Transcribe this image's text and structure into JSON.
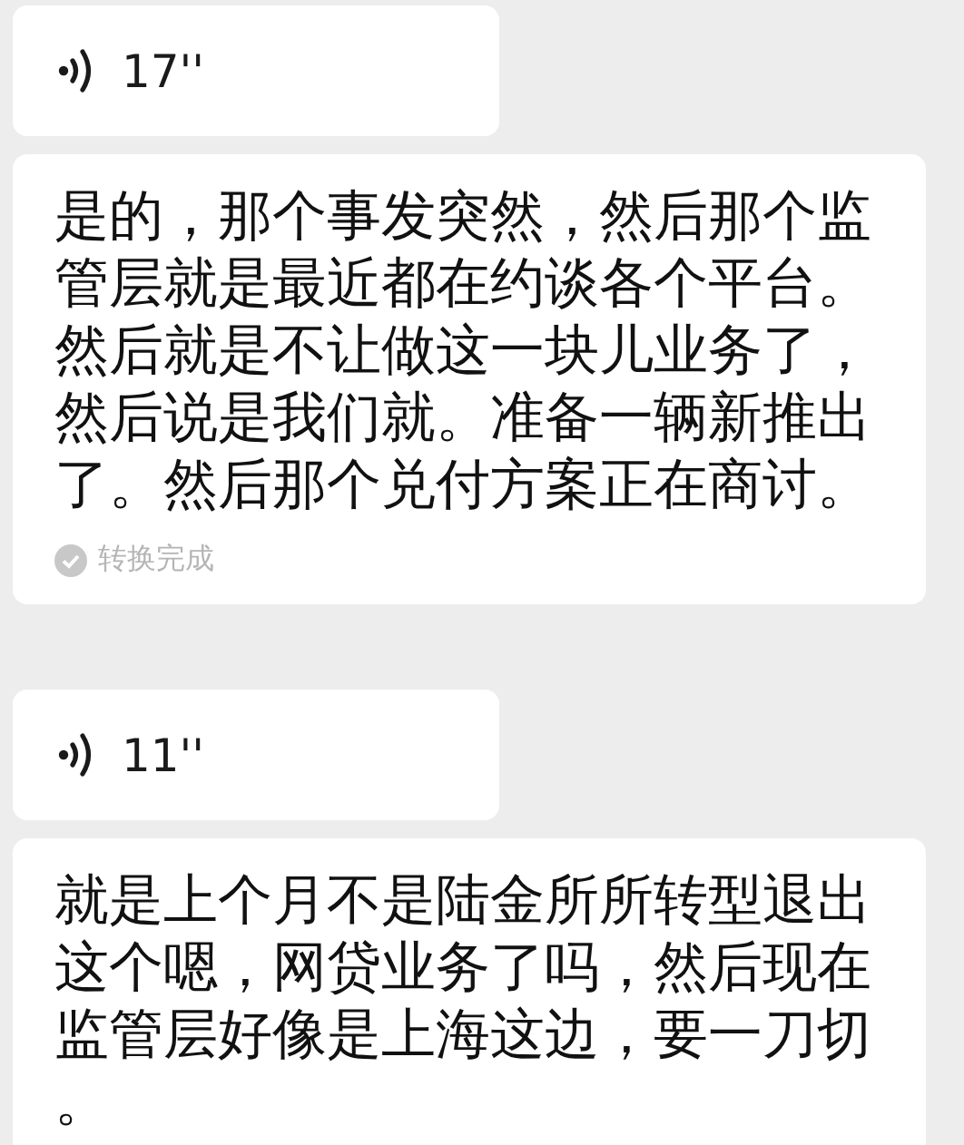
{
  "messages": [
    {
      "kind": "voice",
      "duration": "17''"
    },
    {
      "kind": "transcript",
      "text": "是的，那个事发突然，然后那个监管层就是最近都在约谈各个平台。然后就是不让做这一块儿业务了，然后说是我们就。准备一辆新推出了。然后那个兑付方案正在商讨。",
      "status": "转换完成"
    },
    {
      "kind": "voice",
      "duration": "11''"
    },
    {
      "kind": "transcript",
      "text": "就是上个月不是陆金所所转型退出这个嗯，网贷业务了吗，然后现在监管层好像是上海这边，要一刀切。"
    }
  ]
}
